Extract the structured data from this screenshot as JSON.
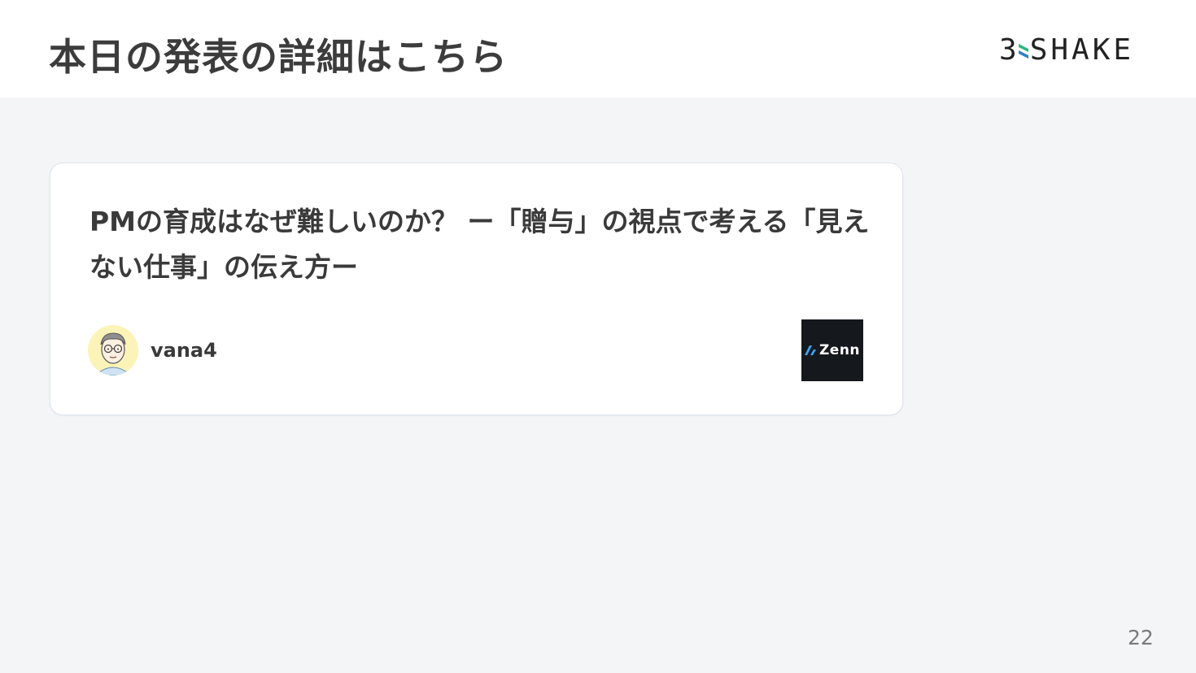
{
  "header": {
    "title": "本日の発表の詳細はこちら",
    "brand_number": "3",
    "brand_name": "SHAKE"
  },
  "card": {
    "title": "PMの育成はなぜ難しいのか？ ー「贈与」の視点で考える「見えない仕事」の伝え方ー",
    "author": "vana4",
    "platform": "Zenn"
  },
  "footer": {
    "page_number": "22"
  },
  "colors": {
    "background": "#f3f5f7",
    "header_background": "#ffffff",
    "card_border": "#dde3ea",
    "zenn_badge": "#15181d",
    "zenn_accent": "#3ea8ff",
    "brand_green": "#2fb67c",
    "brand_blue": "#2f80c3"
  },
  "icons": {
    "brand": "three-shake-logo-icon",
    "avatar": "cartoon-face-avatar-icon",
    "platform": "zenn-logo-icon"
  }
}
